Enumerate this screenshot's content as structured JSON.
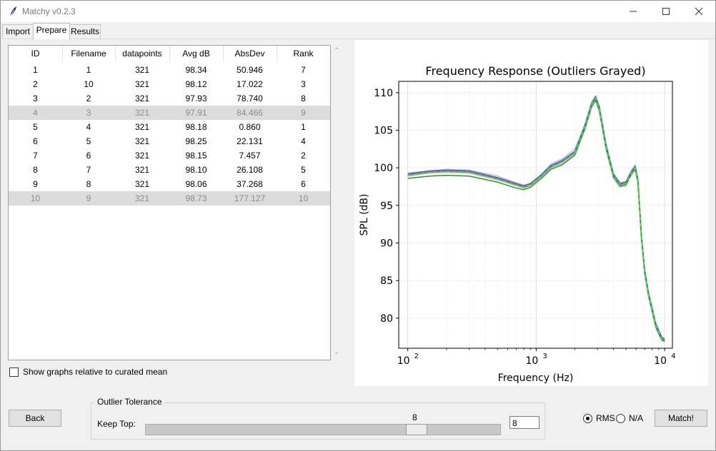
{
  "app": {
    "title": "Matchy v0.2.3"
  },
  "tabs": [
    {
      "label": "Import"
    },
    {
      "label": "Prepare"
    },
    {
      "label": "Results"
    }
  ],
  "table": {
    "columns": [
      "ID",
      "Filename",
      "datapoints",
      "Avg dB",
      "AbsDev",
      "Rank"
    ],
    "rows": [
      {
        "cells": [
          "1",
          "1",
          "321",
          "98.34",
          "50.946",
          "7"
        ],
        "grayed": false
      },
      {
        "cells": [
          "2",
          "10",
          "321",
          "98.12",
          "17.022",
          "3"
        ],
        "grayed": false
      },
      {
        "cells": [
          "3",
          "2",
          "321",
          "97.93",
          "78.740",
          "8"
        ],
        "grayed": false
      },
      {
        "cells": [
          "4",
          "3",
          "321",
          "97.91",
          "84.466",
          "9"
        ],
        "grayed": true
      },
      {
        "cells": [
          "5",
          "4",
          "321",
          "98.18",
          "0.860",
          "1"
        ],
        "grayed": false
      },
      {
        "cells": [
          "6",
          "5",
          "321",
          "98.25",
          "22.131",
          "4"
        ],
        "grayed": false
      },
      {
        "cells": [
          "7",
          "6",
          "321",
          "98.15",
          "7.457",
          "2"
        ],
        "grayed": false
      },
      {
        "cells": [
          "8",
          "7",
          "321",
          "98.10",
          "26.108",
          "5"
        ],
        "grayed": false
      },
      {
        "cells": [
          "9",
          "8",
          "321",
          "98.06",
          "37.268",
          "6"
        ],
        "grayed": false
      },
      {
        "cells": [
          "10",
          "9",
          "321",
          "98.73",
          "177.127",
          "10"
        ],
        "grayed": true
      }
    ]
  },
  "options": {
    "relative_label": "Show graphs relative to curated mean",
    "relative_checked": false
  },
  "chart_data": {
    "type": "line",
    "title": "Frequency Response (Outliers Grayed)",
    "xlabel": "Frequency (Hz)",
    "ylabel": "SPL (dB)",
    "xscale": "log",
    "xlim": [
      85,
      11500
    ],
    "ylim": [
      76,
      111.5
    ],
    "xticks": [
      100,
      1000,
      10000
    ],
    "xtick_labels": [
      "10",
      "10",
      "10"
    ],
    "xtick_exponents": [
      "2",
      "3",
      "4"
    ],
    "yticks": [
      80,
      85,
      90,
      95,
      100,
      105,
      110
    ],
    "grid": true,
    "x": [
      100,
      150,
      200,
      300,
      500,
      700,
      800,
      900,
      1100,
      1300,
      1600,
      2000,
      2400,
      2700,
      2900,
      3100,
      3500,
      4000,
      4500,
      5000,
      5500,
      5900,
      6200,
      6600,
      7000,
      7500,
      8000,
      8500,
      9000,
      9500,
      10000
    ],
    "series": [
      {
        "role": "grayed",
        "color": "#c0c6d8",
        "values": [
          99.3,
          99.6,
          99.8,
          99.7,
          98.9,
          98.0,
          97.7,
          97.9,
          99.1,
          100.5,
          101.2,
          102.5,
          105.8,
          108.7,
          109.6,
          108.2,
          103.2,
          99.3,
          98.0,
          98.2,
          99.6,
          100.4,
          98.5,
          91.0,
          86.5,
          83.5,
          81.5,
          79.5,
          78.5,
          77.5,
          77.2
        ]
      },
      {
        "role": "grayed",
        "color": "#c0c6d8",
        "values": [
          98.9,
          99.3,
          99.4,
          99.3,
          98.4,
          97.6,
          97.3,
          97.6,
          98.8,
          100.0,
          100.6,
          101.8,
          105.3,
          108.2,
          109.2,
          107.8,
          102.6,
          98.8,
          97.6,
          97.8,
          99.2,
          100.0,
          98.1,
          90.6,
          86.0,
          83.0,
          81.0,
          79.0,
          78.0,
          77.2,
          76.9
        ]
      },
      {
        "role": "curve",
        "color": "#8a8a8a",
        "values": [
          99.0,
          99.4,
          99.5,
          99.4,
          98.5,
          97.7,
          97.4,
          97.7,
          98.9,
          100.1,
          100.8,
          102.0,
          105.5,
          108.4,
          109.3,
          107.9,
          102.8,
          98.9,
          97.7,
          97.9,
          99.3,
          100.0,
          98.2,
          90.7,
          86.1,
          83.1,
          81.1,
          79.1,
          78.1,
          77.3,
          77.0
        ]
      },
      {
        "role": "curve",
        "color": "#e05a5a",
        "values": [
          99.1,
          99.5,
          99.6,
          99.5,
          98.6,
          97.8,
          97.5,
          97.8,
          99.0,
          100.2,
          100.9,
          102.1,
          105.6,
          108.5,
          109.4,
          108.0,
          102.9,
          99.0,
          97.8,
          98.0,
          99.4,
          100.1,
          98.3,
          90.8,
          86.2,
          83.2,
          81.2,
          79.2,
          78.2,
          77.4,
          77.1
        ]
      },
      {
        "role": "curve",
        "color": "#5b5bd6",
        "values": [
          99.2,
          99.6,
          99.7,
          99.6,
          98.7,
          97.9,
          97.6,
          97.9,
          99.1,
          100.3,
          101.0,
          102.2,
          105.7,
          108.6,
          109.5,
          108.1,
          103.0,
          99.1,
          97.9,
          98.1,
          99.5,
          100.2,
          98.4,
          90.9,
          86.3,
          83.3,
          81.3,
          79.3,
          78.3,
          77.5,
          77.2
        ]
      },
      {
        "role": "curve",
        "color": "#3a9a3a",
        "values": [
          98.6,
          98.9,
          99.0,
          98.9,
          98.1,
          97.3,
          97.1,
          97.4,
          98.6,
          99.8,
          100.4,
          101.7,
          105.2,
          108.1,
          109.0,
          107.6,
          102.5,
          98.7,
          97.5,
          97.7,
          99.1,
          99.8,
          98.0,
          90.5,
          85.9,
          82.9,
          80.9,
          78.9,
          77.9,
          77.1,
          76.9
        ]
      },
      {
        "role": "mean",
        "color": "#41e041",
        "dashed": true,
        "values": [
          99.0,
          99.4,
          99.5,
          99.4,
          98.5,
          97.7,
          97.4,
          97.7,
          98.9,
          100.1,
          100.8,
          102.0,
          105.5,
          108.4,
          109.3,
          107.9,
          102.8,
          98.9,
          97.7,
          97.9,
          99.3,
          100.0,
          98.2,
          90.7,
          86.1,
          83.1,
          81.1,
          79.1,
          78.1,
          77.3,
          77.0
        ]
      }
    ]
  },
  "controls": {
    "back_label": "Back",
    "group_label": "Outlier Tolerance",
    "keep_top_label": "Keep Top:",
    "slider_value": "8",
    "slider_min": 1,
    "slider_max": 10,
    "entry_value": "8",
    "radio_rms": "RMS",
    "radio_na": "N/A",
    "selected_radio": "RMS",
    "match_label": "Match!"
  }
}
